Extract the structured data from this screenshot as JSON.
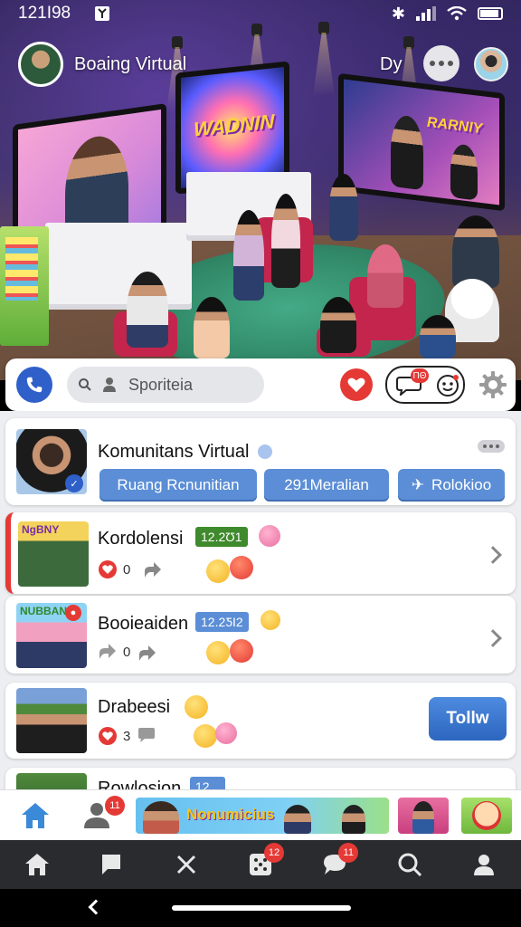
{
  "status_bar": {
    "time": "121I98"
  },
  "header": {
    "title": "Boaing Virtual",
    "user_label": "Dy"
  },
  "search": {
    "placeholder": "Sporiteia",
    "chat_badge": "ΠΘ"
  },
  "community": {
    "name": "Komunitans Virtual",
    "buttons": [
      "Ruang Rcnunitian",
      "291Meralian",
      "Rolokioo"
    ]
  },
  "feed": [
    {
      "title": "Kordolensi",
      "tag": "12.2Ʊ1",
      "tag_color": "#3f8a2c",
      "likes": "0",
      "thumb_text": "NgBNY"
    },
    {
      "title": "Booieaiden",
      "tag": "12.2ƼI2",
      "tag_color": "#5b8ed6",
      "likes": "0",
      "thumb_text": "NUBBAN"
    },
    {
      "title": "Drabeesi",
      "likes": "3",
      "follow_label": "Tollw"
    },
    {
      "title": "Rowlosion",
      "tag": "12..."
    }
  ],
  "tabstrip": {
    "profile_badge": "11",
    "banner_text": "Nonumicius"
  },
  "bottom_nav": {
    "badge_games": "12",
    "badge_chat": "11"
  },
  "hero_tv_texts": {
    "tv2": "WADNIN",
    "tv3": "RARNIY"
  },
  "colors": {
    "accent": "#2f5fc9",
    "danger": "#e53935",
    "button_blue": "#5b8ed6"
  }
}
